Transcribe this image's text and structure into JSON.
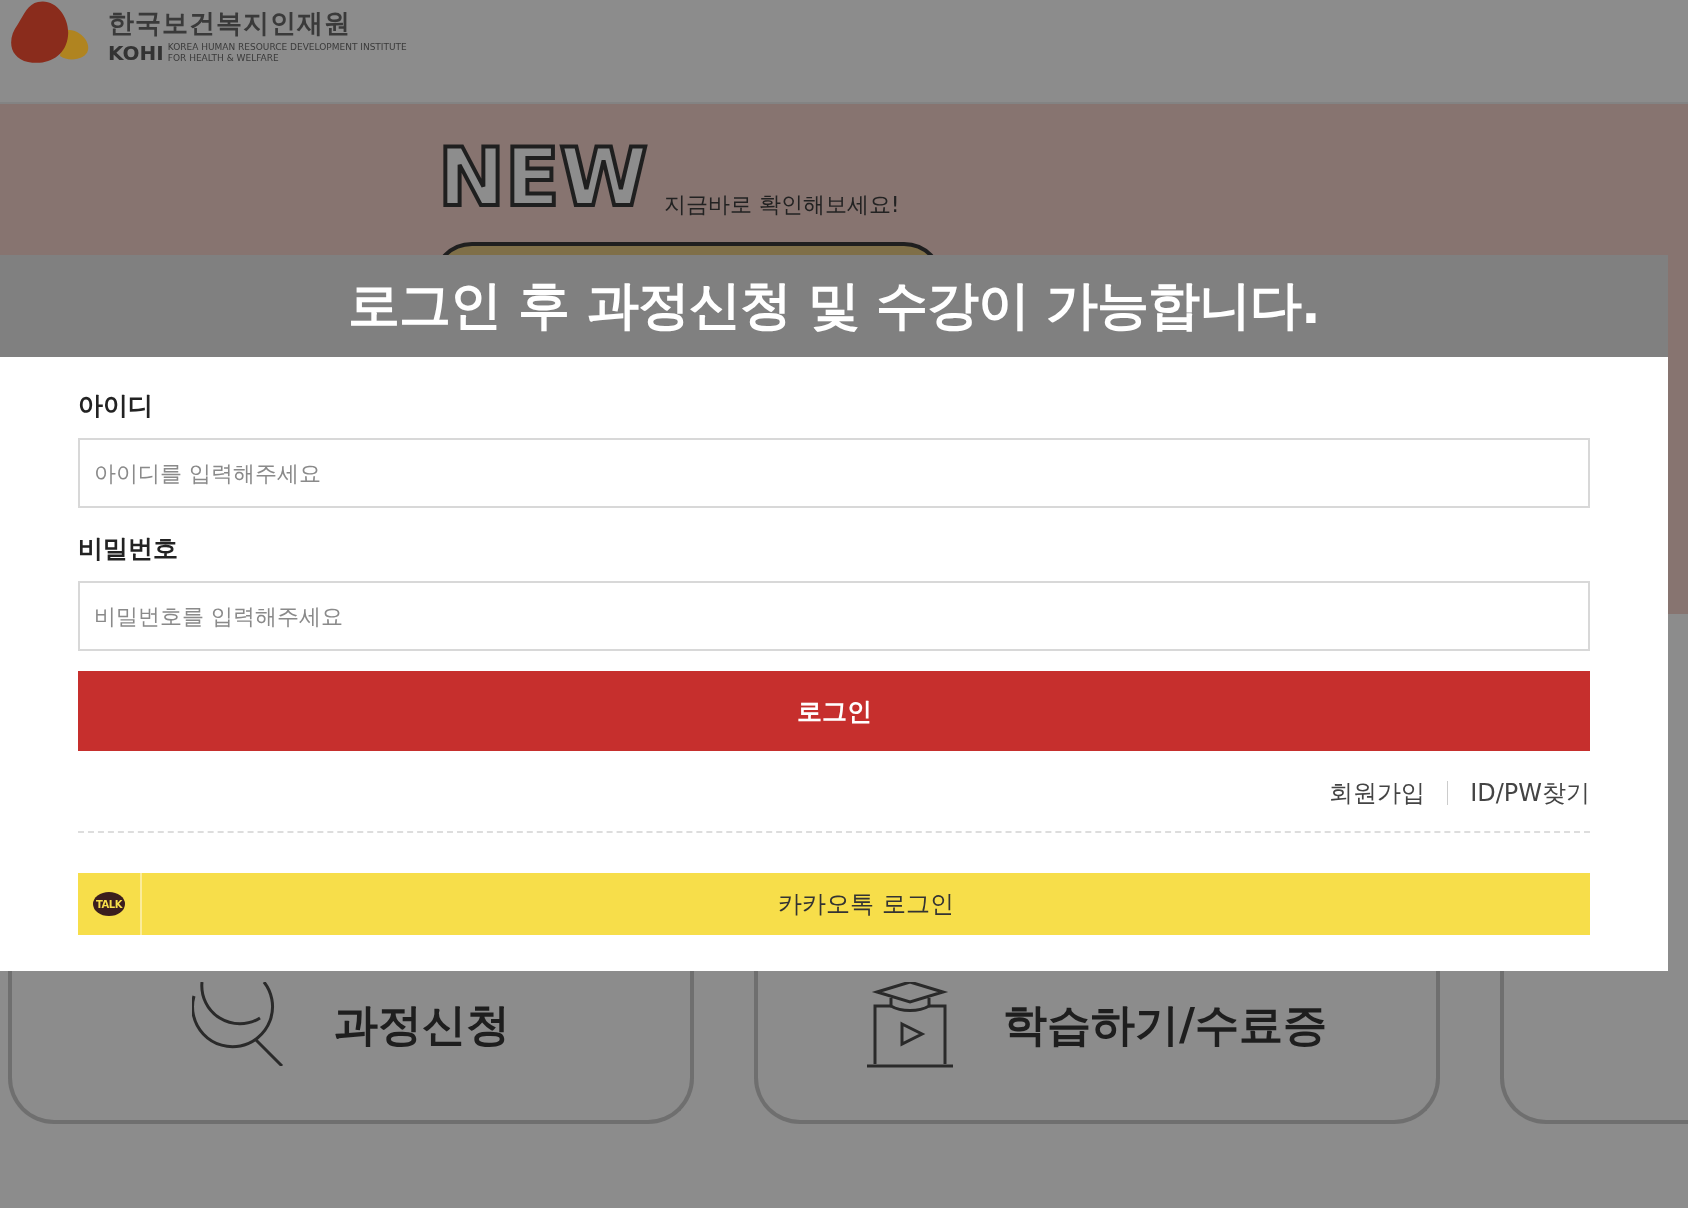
{
  "header": {
    "logo_name": "한국보건복지인재원",
    "logo_abbr": "KOHI",
    "logo_subtitle_1": "KOREA HUMAN RESOURCE DEVELOPMENT INSTITUTE",
    "logo_subtitle_2": "FOR HEALTH & WELFARE"
  },
  "banner": {
    "badge": "NEW",
    "tagline": "지금바로 확인해보세요!"
  },
  "menu_cards": [
    {
      "kind": "search",
      "label": "과정신청"
    },
    {
      "kind": "lecture",
      "label": "학습하기/수료증"
    },
    {
      "kind": "blank"
    }
  ],
  "login_modal": {
    "title": "로그인 후 과정신청 및 수강이 가능합니다.",
    "fields": [
      {
        "label": "아이디",
        "placeholder": "아이디를 입력해주세요"
      },
      {
        "label": "비밀번호",
        "placeholder": "비밀번호를 입력해주세요"
      }
    ],
    "login_button": "로그인",
    "links": [
      "회원가입",
      "ID/PW찾기"
    ],
    "kakao_button": {
      "icon_text": "TALK",
      "label": "카카오톡 로그인"
    }
  }
}
